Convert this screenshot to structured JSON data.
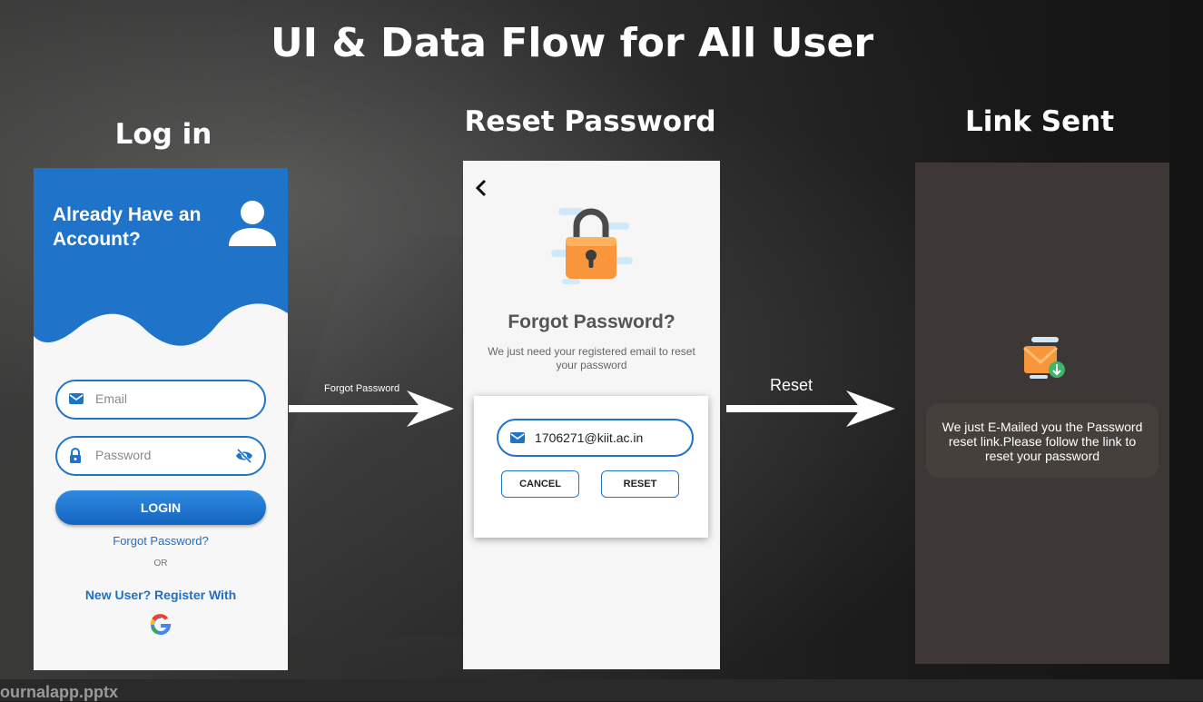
{
  "slide": {
    "title": "UI & Data Flow for All User",
    "file_label": "ournalapp.pptx"
  },
  "login": {
    "heading": "Log in",
    "header_text": "Already Have an Account?",
    "email_placeholder": "Email",
    "password_placeholder": "Password",
    "login_button": "LOGIN",
    "forgot_link": "Forgot Password?",
    "or_text": "OR",
    "register_text": "New User? Register With",
    "icons": [
      "user-icon",
      "email-icon",
      "lock-icon",
      "eye-off-icon",
      "google-icon"
    ],
    "accent_color": "#1f74c9"
  },
  "arrows": {
    "first_label": "Forgot Password",
    "second_label": "Reset"
  },
  "reset": {
    "heading": "Reset Password",
    "title": "Forgot Password?",
    "subtitle": "We just need your registered email to reset your password",
    "email_value": "1706271@kiit.ac.in",
    "cancel_button": "CANCEL",
    "reset_button": "RESET",
    "icons": [
      "back-arrow-icon",
      "padlock-icon",
      "email-icon"
    ]
  },
  "link_sent": {
    "heading": "Link Sent",
    "message": "We just E-Mailed you the Password reset link.Please follow the link to reset your password",
    "icons": [
      "mail-download-icon"
    ],
    "screen_color": "#3d3835"
  }
}
